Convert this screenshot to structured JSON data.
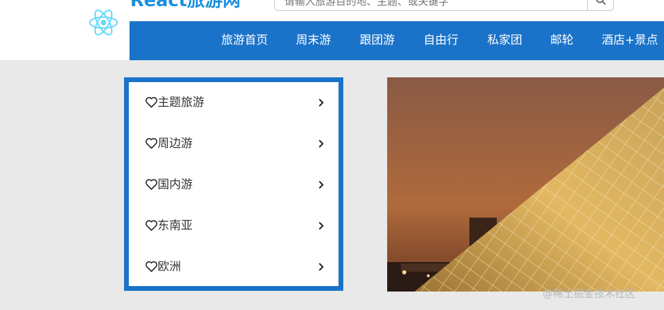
{
  "header": {
    "brand": "React旅游网",
    "search_placeholder": "请输入旅游目的地、主题、或关键字"
  },
  "nav": {
    "items": [
      "旅游首页",
      "周末游",
      "跟团游",
      "自由行",
      "私家团",
      "邮轮",
      "酒店+景点"
    ]
  },
  "menu": {
    "items": [
      {
        "label": "主题旅游"
      },
      {
        "label": "周边游"
      },
      {
        "label": "国内游"
      },
      {
        "label": "东南亚"
      },
      {
        "label": "欧洲"
      }
    ]
  },
  "carousel": {
    "image": "louvre-pyramid-night"
  },
  "watermark": "@稀土掘金技术社区",
  "colors": {
    "primary": "#1a73c9",
    "brand_text": "#1a8fe0",
    "page_bg": "#e9e9e9"
  },
  "icons": {
    "logo": "react-atom-icon",
    "search": "search-icon",
    "menu_item": "heart-icon",
    "menu_arrow": "chevron-right-icon"
  }
}
